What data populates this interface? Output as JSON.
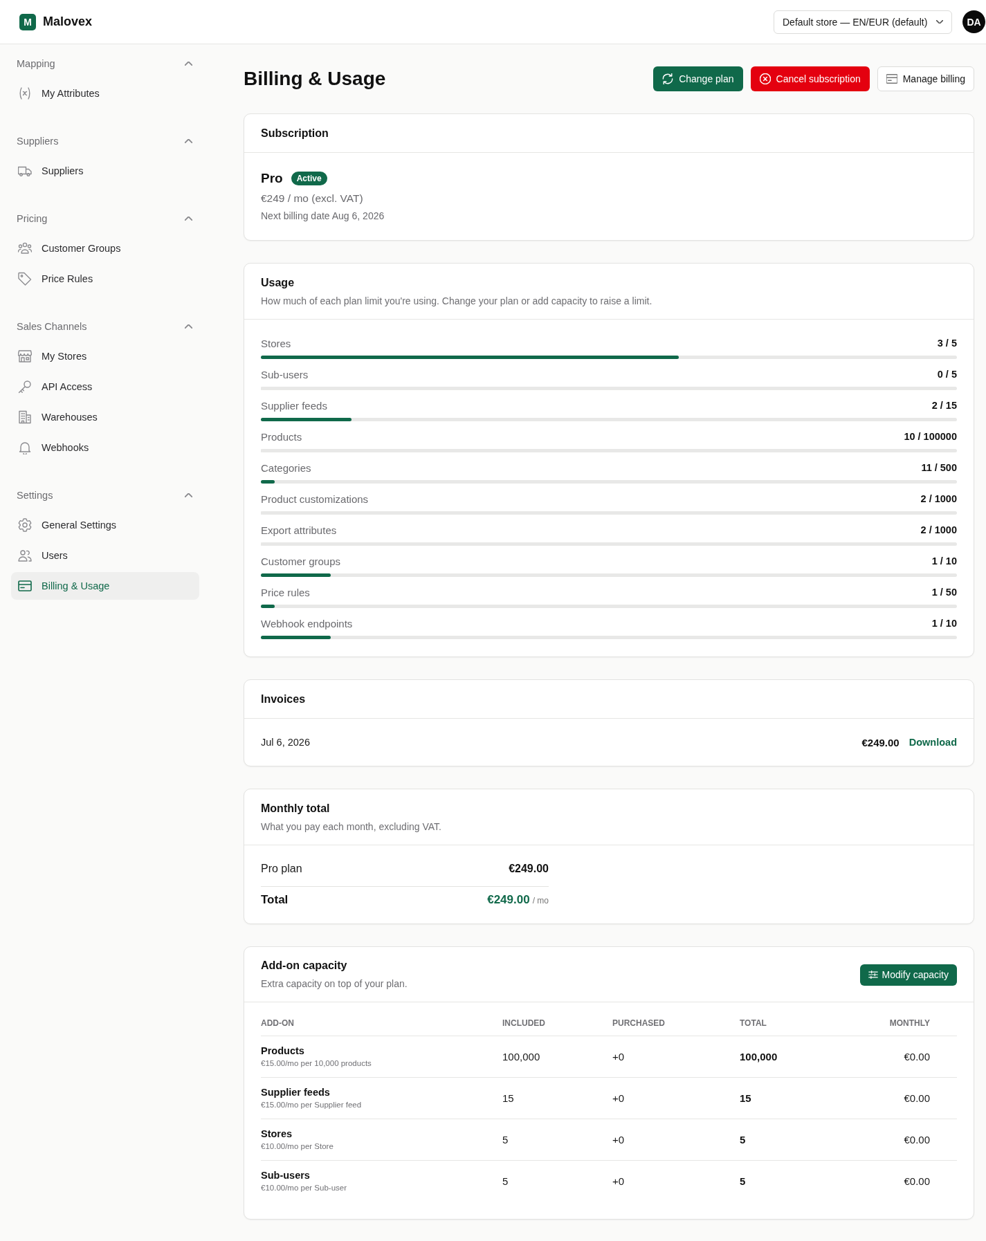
{
  "top_bar": {
    "logo_letter": "M",
    "brand": "Malovex",
    "store_select": "Default store — EN/EUR (default)",
    "avatar": "DA"
  },
  "sidebar": {
    "sections": [
      {
        "title": "Mapping",
        "expanded": true,
        "items": [
          {
            "label": "My Attributes",
            "selected": false
          }
        ]
      },
      {
        "title": "Suppliers",
        "expanded": true,
        "items": [
          {
            "label": "Suppliers",
            "selected": false
          }
        ]
      },
      {
        "title": "Pricing",
        "expanded": true,
        "items": [
          {
            "label": "Customer Groups",
            "selected": false
          },
          {
            "label": "Price Rules",
            "selected": false
          }
        ]
      },
      {
        "title": "Sales Channels",
        "expanded": true,
        "items": [
          {
            "label": "My Stores",
            "selected": false
          },
          {
            "label": "API Access",
            "selected": false
          },
          {
            "label": "Warehouses",
            "selected": false
          },
          {
            "label": "Webhooks",
            "selected": false
          }
        ]
      },
      {
        "title": "Settings",
        "expanded": true,
        "items": [
          {
            "label": "General Settings",
            "selected": false
          },
          {
            "label": "Users",
            "selected": false
          },
          {
            "label": "Billing & Usage",
            "selected": true
          }
        ]
      }
    ]
  },
  "page": {
    "title": "Billing & Usage",
    "actions": [
      {
        "label": "Change plan",
        "kind": "primary"
      },
      {
        "label": "Cancel subscription",
        "kind": "danger"
      },
      {
        "label": "Manage billing",
        "kind": "secondary"
      }
    ]
  },
  "subscription": {
    "title": "Subscription",
    "plan": "Pro",
    "status": "Active",
    "price": "€249 / mo (excl. VAT)",
    "next_billing": "Next billing date Aug 6, 2026"
  },
  "usage": {
    "title": "Usage",
    "description": "How much of each plan limit you're using. Change your plan or add capacity to raise a limit.",
    "rows": [
      {
        "name": "Stores",
        "reading": "3 / 5",
        "level": 0.6
      },
      {
        "name": "Sub-users",
        "reading": "0 / 5",
        "level": 0
      },
      {
        "name": "Supplier feeds",
        "reading": "2 / 15",
        "level": 0.13
      },
      {
        "name": "Products",
        "reading": "10 / 100000",
        "level": 0
      },
      {
        "name": "Categories",
        "reading": "11 / 500",
        "level": 0.02
      },
      {
        "name": "Product customizations",
        "reading": "2 / 1000",
        "level": 0
      },
      {
        "name": "Export attributes",
        "reading": "2 / 1000",
        "level": 0
      },
      {
        "name": "Customer groups",
        "reading": "1 / 10",
        "level": 0.1
      },
      {
        "name": "Price rules",
        "reading": "1 / 50",
        "level": 0.02
      },
      {
        "name": "Webhook endpoints",
        "reading": "1 / 10",
        "level": 0.1
      }
    ]
  },
  "invoices": {
    "title": "Invoices",
    "rows": [
      {
        "date": "Jul 6, 2026",
        "amount": "€249.00",
        "action": "Download"
      }
    ]
  },
  "monthly_total": {
    "title": "Monthly total",
    "description": "What you pay each month, excluding VAT.",
    "lines": [
      {
        "label": "Pro plan",
        "amount": "€249.00"
      }
    ],
    "total": {
      "label": "Total",
      "amount": "€249.00",
      "unit": "/ mo"
    }
  },
  "addon_capacity": {
    "title": "Add-on capacity",
    "description": "Extra capacity on top of your plan.",
    "button": "Modify capacity",
    "columns": [
      "ADD-ON",
      "INCLUDED",
      "PURCHASED",
      "TOTAL",
      "MONTHLY"
    ],
    "rows": [
      {
        "name": "Products",
        "price": "€15.00/mo per 10,000 products",
        "included": "100,000",
        "purchased": "+0",
        "total": "100,000",
        "monthly": "€0.00"
      },
      {
        "name": "Supplier feeds",
        "price": "€15.00/mo per Supplier feed",
        "included": "15",
        "purchased": "+0",
        "total": "15",
        "monthly": "€0.00"
      },
      {
        "name": "Stores",
        "price": "€10.00/mo per Store",
        "included": "5",
        "purchased": "+0",
        "total": "5",
        "monthly": "€0.00"
      },
      {
        "name": "Sub-users",
        "price": "€10.00/mo per Sub-user",
        "included": "5",
        "purchased": "+0",
        "total": "5",
        "monthly": "€0.00"
      }
    ]
  }
}
